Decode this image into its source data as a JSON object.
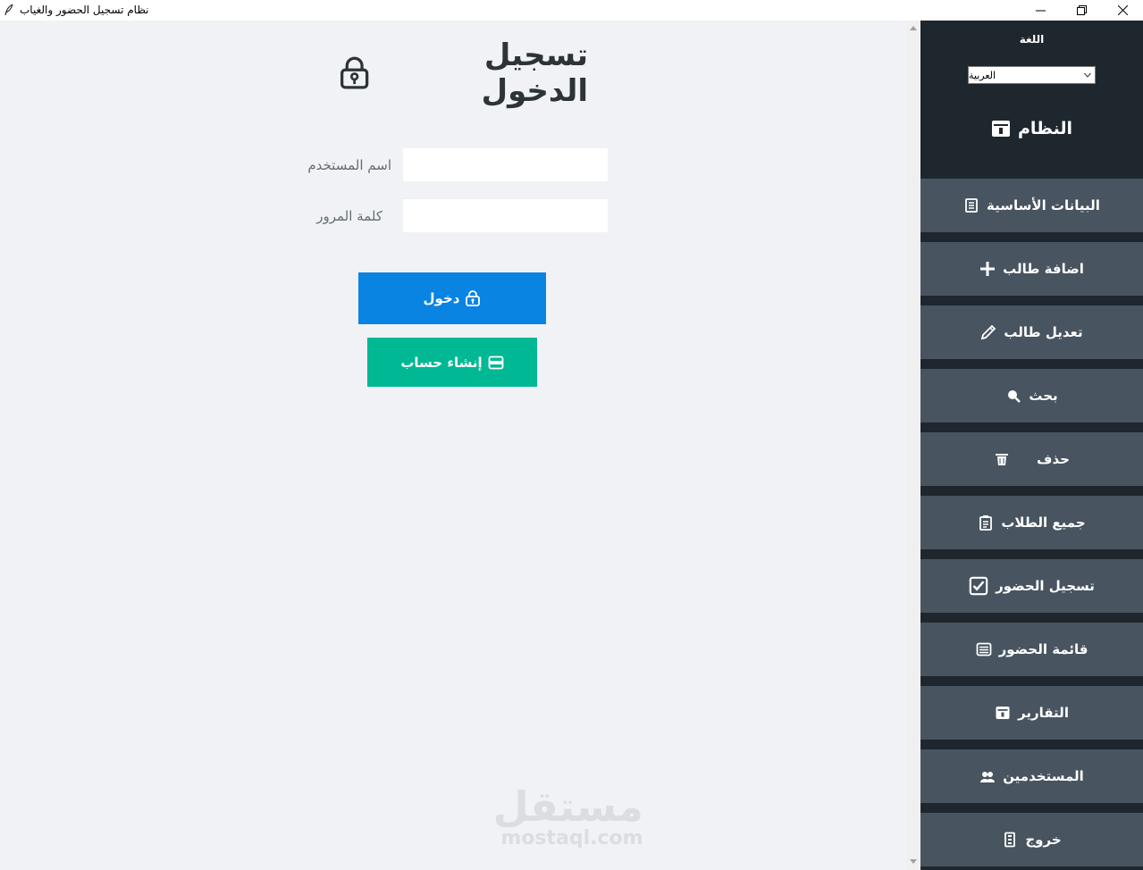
{
  "window": {
    "title": "نظام تسجيل الحضور والغياب"
  },
  "login": {
    "title": "تسجيل الدخول",
    "username_label": "اسم المستخدم",
    "password_label": "كلمة المرور",
    "username_value": "",
    "password_value": "",
    "login_button": "دخول",
    "register_button": "إنشاء حساب"
  },
  "watermark": {
    "arabic": "مستقل",
    "latin": "mostaql.com"
  },
  "sidebar": {
    "language_label": "اللغة",
    "language_selected": "العربية",
    "system_title": "النظام",
    "items": [
      {
        "label": "البيانات الأساسية",
        "icon": "document-icon"
      },
      {
        "label": "اضافة طالب",
        "icon": "plus-icon"
      },
      {
        "label": "تعديل طالب",
        "icon": "pencil-icon"
      },
      {
        "label": "بحث",
        "icon": "search-icon"
      },
      {
        "label": "حذف",
        "icon": "trash-icon"
      },
      {
        "label": "جميع الطلاب",
        "icon": "clipboard-icon"
      },
      {
        "label": "تسجيل الحضور",
        "icon": "checkbox-icon"
      },
      {
        "label": "قائمة الحضور",
        "icon": "list-icon"
      },
      {
        "label": "التقارير",
        "icon": "report-icon"
      },
      {
        "label": "المستخدمين",
        "icon": "users-icon"
      },
      {
        "label": "خروج",
        "icon": "exit-icon"
      }
    ]
  },
  "colors": {
    "sidebar_bg": "#1e272e",
    "nav_item_bg": "#485460",
    "main_bg": "#f1f2f6",
    "login_button": "#0984e3",
    "register_button": "#00b894",
    "title_text": "#2d3436",
    "label_text": "#636e72"
  }
}
